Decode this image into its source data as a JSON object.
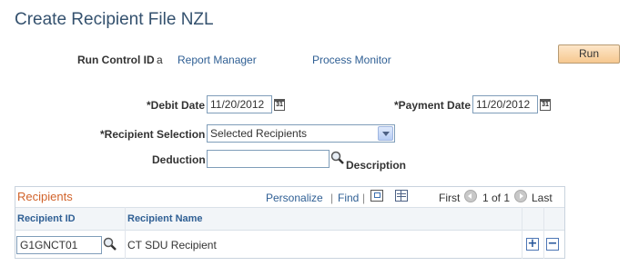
{
  "page": {
    "title": "Create Recipient File NZL"
  },
  "run_control": {
    "label": "Run Control ID",
    "value": "a",
    "report_manager": "Report Manager",
    "process_monitor": "Process Monitor",
    "run_label": "Run"
  },
  "form": {
    "debit_date_label": "*Debit Date",
    "debit_date_value": "11/20/2012",
    "payment_date_label": "*Payment Date",
    "payment_date_value": "11/20/2012",
    "recipient_selection_label": "*Recipient Selection",
    "recipient_selection_value": "Selected Recipients",
    "deduction_label": "Deduction",
    "deduction_value": "",
    "description_label": "Description"
  },
  "grid": {
    "title": "Recipients",
    "personalize": "Personalize",
    "separator": "|",
    "find": "Find",
    "first": "First",
    "pagination": "1 of 1",
    "last": "Last",
    "columns": [
      "Recipient ID",
      "Recipient Name"
    ],
    "rows": [
      {
        "recipient_id": "G1GNCT01",
        "recipient_name": "CT SDU Recipient",
        "add": "+",
        "delete": "−"
      }
    ]
  },
  "colors": {
    "title": "#34516e",
    "link": "#2f5f94",
    "grid_title": "#d1632b",
    "run_button": "#f6c88f"
  },
  "icons": [
    "calendar-icon",
    "lookup-magnifier-icon",
    "dropdown-arrow-icon",
    "view-all-icon",
    "spreadsheet-icon",
    "prev-arrow-icon",
    "next-arrow-icon"
  ]
}
